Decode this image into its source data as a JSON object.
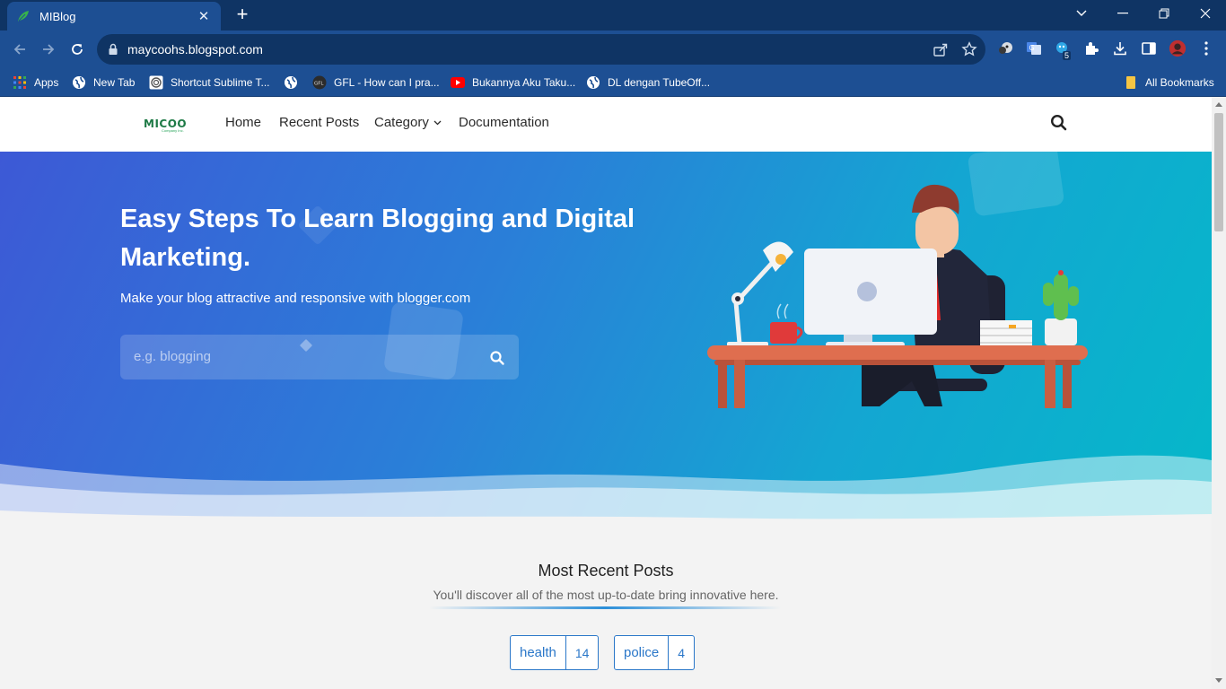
{
  "browser": {
    "tab_title": "MIBlog",
    "url": "maycoohs.blogspot.com",
    "extension_badge": "5",
    "bookmarks": [
      {
        "label": "Apps",
        "icon": "apps-grid-icon"
      },
      {
        "label": "New Tab",
        "icon": "globe-icon"
      },
      {
        "label": "Shortcut Sublime T...",
        "icon": "sublime-icon"
      },
      {
        "label": "",
        "icon": "globe-icon"
      },
      {
        "label": "GFL - How can I pra...",
        "icon": "gfl-icon"
      },
      {
        "label": "Bukannya Aku Taku...",
        "icon": "youtube-icon"
      },
      {
        "label": "DL dengan TubeOff...",
        "icon": "globe-icon"
      }
    ],
    "all_bookmarks_label": "All Bookmarks"
  },
  "site": {
    "logo_text": "MICOO",
    "logo_sub": "Company Inc.",
    "nav": {
      "home": "Home",
      "recent": "Recent Posts",
      "category": "Category",
      "docs": "Documentation"
    },
    "hero": {
      "title": "Easy Steps To Learn Blogging and Digital Marketing.",
      "subtitle": "Make your blog attractive and responsive with blogger.com",
      "search_placeholder": "e.g. blogging"
    },
    "recent": {
      "heading": "Most Recent Posts",
      "description": "You'll discover all of the most up-to-date bring innovative here.",
      "tags": [
        {
          "name": "health",
          "count": "14"
        },
        {
          "name": "police",
          "count": "4"
        }
      ]
    }
  },
  "colors": {
    "chrome_dark": "#0f3464",
    "chrome_light": "#1d4f93",
    "hero_start": "#3d59d6",
    "hero_end": "#05b8c9",
    "tag_blue": "#2a77c9"
  }
}
